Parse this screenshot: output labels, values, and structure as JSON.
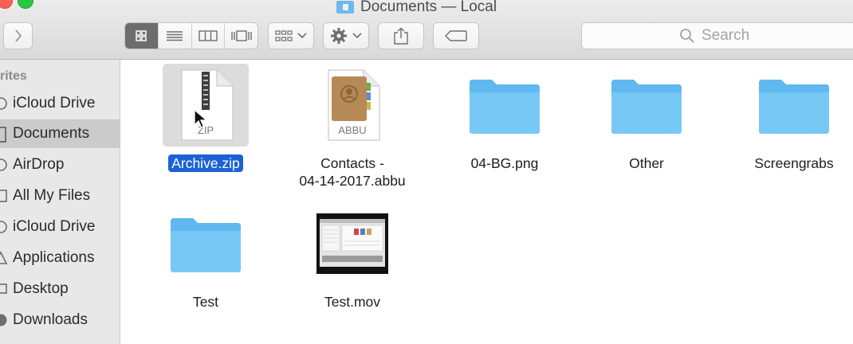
{
  "window": {
    "title": "Documents — Local"
  },
  "toolbar": {
    "view_modes": [
      "icon-view",
      "list-view",
      "column-view",
      "coverflow-view"
    ],
    "active_view": "icon-view",
    "search_placeholder": "Search"
  },
  "sidebar": {
    "heading": "rites",
    "items": [
      {
        "label": "iCloud Drive",
        "icon": "cloud-icon",
        "selected": false
      },
      {
        "label": "Documents",
        "icon": "document-icon",
        "selected": true
      },
      {
        "label": "AirDrop",
        "icon": "airdrop-icon",
        "selected": false
      },
      {
        "label": "All My Files",
        "icon": "files-icon",
        "selected": false
      },
      {
        "label": "iCloud Drive",
        "icon": "cloud-icon",
        "selected": false
      },
      {
        "label": "Applications",
        "icon": "applications-icon",
        "selected": false
      },
      {
        "label": "Desktop",
        "icon": "desktop-icon",
        "selected": false
      },
      {
        "label": "Downloads",
        "icon": "download-icon",
        "selected": false
      }
    ]
  },
  "files": [
    {
      "name": "Archive.zip",
      "kind": "zip",
      "thumb_label": "ZIP",
      "selected": true
    },
    {
      "name": "Contacts - 04-14-2017.abbu",
      "name_lines": [
        "Contacts -",
        "04-14-2017.abbu"
      ],
      "kind": "abbu",
      "thumb_label": "ABBU",
      "selected": false
    },
    {
      "name": "04-BG.png",
      "kind": "folder",
      "selected": false
    },
    {
      "name": "Other",
      "kind": "folder",
      "selected": false
    },
    {
      "name": "Screengrabs",
      "kind": "folder",
      "selected": false
    },
    {
      "name": "Test",
      "kind": "folder",
      "selected": false
    },
    {
      "name": "Test.mov",
      "kind": "movie",
      "selected": false
    }
  ],
  "colors": {
    "selection": "#1c62d6",
    "folder": "#6cc3f5",
    "sidebar_bg": "#e8e8e8"
  }
}
